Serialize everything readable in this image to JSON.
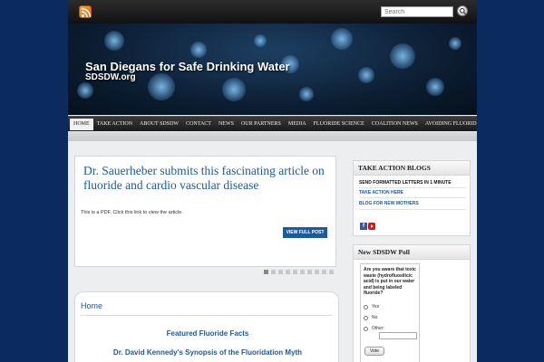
{
  "header": {
    "search_placeholder": "Search",
    "site_title": "San Diegans for Safe Drinking Water",
    "site_subtitle": "SDSDW.org"
  },
  "nav": {
    "items": [
      "HOME",
      "TAKE ACTION",
      "ABOUT SDSDW",
      "CONTACT",
      "NEWS",
      "OUR PARTNERS",
      "MEDIA",
      "FLUORIDE SCIENCE",
      "COALITION NEWS",
      "AVOIDING FLUORIDE"
    ],
    "active_index": 0
  },
  "feature": {
    "title": "Dr. Sauerheber submits this fascinating article on fluoride and cardio vascular disease",
    "text": "This is a PDF.  Click this link to view the article.",
    "button": "VIEW FULL POST",
    "slide_count": 10,
    "active_slide": 0
  },
  "main": {
    "heading": "Home",
    "links": [
      "Featured Fluoride Facts",
      "Dr. David Kennedy's Synopsis of the Fluoridation Myth"
    ]
  },
  "sidebar": {
    "blogs_title": "TAKE ACTION BLOGS",
    "blog_links": [
      "SEND FORMATTED LETTERS IN 1 MINUTE",
      "TAKE ACTION HERE",
      "BLOG FOR NEW MOTHERS"
    ],
    "social_icons": [
      "facebook-icon",
      "youtube-icon"
    ],
    "poll_title": "New SDSDW Poll",
    "poll_question": "Are you aware that toxic waste (hydrofluosilicic acid) is put in our water and being labeled fluoride?",
    "poll_options": [
      "Yes",
      "No",
      "Other:"
    ],
    "vote_label": "Vote"
  },
  "colors": {
    "background": "#0b2a5e",
    "link_blue": "#1c5aa0",
    "nav_dark": "#1a1a1a"
  }
}
